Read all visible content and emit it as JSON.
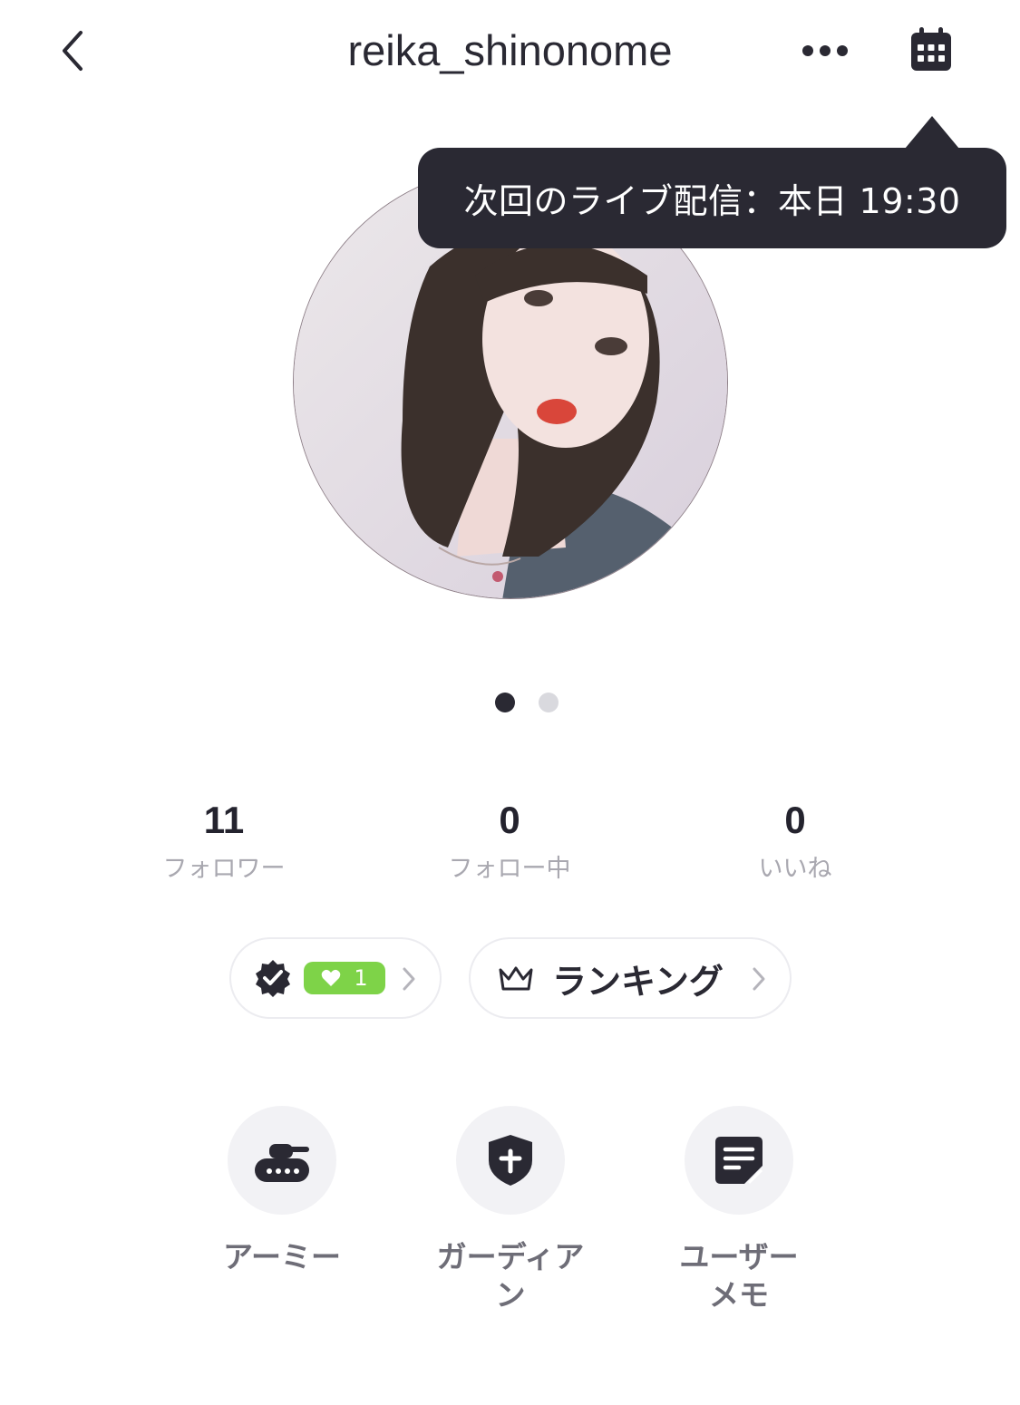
{
  "header": {
    "username": "reika_shinonome",
    "icons": {
      "back": "chevron-left-icon",
      "more": "more-dots-icon",
      "calendar": "calendar-icon"
    }
  },
  "tooltip": {
    "text": "次回のライブ配信：本日 19:30"
  },
  "profile": {
    "avatar": "profile-photo",
    "pager": {
      "count": 2,
      "active_index": 0
    }
  },
  "stats": [
    {
      "value": "11",
      "label": "フォロワー"
    },
    {
      "value": "0",
      "label": "フォロー中"
    },
    {
      "value": "0",
      "label": "いいね"
    }
  ],
  "pills": {
    "badge": {
      "icon": "verified-badge-icon",
      "heart_icon": "heart-icon",
      "count": "1",
      "chip_color": "#7ed348"
    },
    "ranking": {
      "icon": "crown-icon",
      "label": "ランキング"
    }
  },
  "actions": [
    {
      "icon": "tank-icon",
      "label": "アーミー"
    },
    {
      "icon": "shield-plus-icon",
      "label": "ガーディア\nン"
    },
    {
      "icon": "note-edit-icon",
      "label": "ユーザー\nメモ"
    }
  ],
  "colors": {
    "text": "#2a2933",
    "muted": "#a9a8b0",
    "action_bg": "#f2f2f5",
    "tooltip_bg": "#2a2933"
  }
}
